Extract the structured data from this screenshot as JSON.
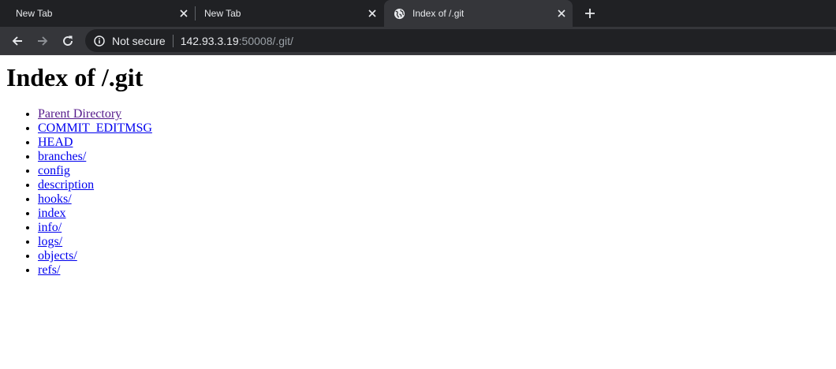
{
  "tabs": [
    {
      "title": "New Tab",
      "active": false
    },
    {
      "title": "New Tab",
      "active": false
    },
    {
      "title": "Index of /.git",
      "active": true
    }
  ],
  "icons": {
    "tab_close": "close-icon",
    "new_tab": "plus-icon",
    "back": "arrow-left-icon",
    "forward": "arrow-right-icon",
    "reload": "reload-icon",
    "site_info": "info-icon",
    "favicon": "globe-icon"
  },
  "address_bar": {
    "security_label": "Not secure",
    "url_host": "142.93.3.19",
    "url_rest": ":50008/.git/"
  },
  "page": {
    "heading": "Index of /.git",
    "entries": [
      {
        "label": "Parent Directory",
        "visited": true
      },
      {
        "label": "COMMIT_EDITMSG",
        "visited": false
      },
      {
        "label": "HEAD",
        "visited": false
      },
      {
        "label": "branches/",
        "visited": false
      },
      {
        "label": "config",
        "visited": false
      },
      {
        "label": "description",
        "visited": false
      },
      {
        "label": "hooks/",
        "visited": false
      },
      {
        "label": "index",
        "visited": false
      },
      {
        "label": "info/",
        "visited": false
      },
      {
        "label": "logs/",
        "visited": false
      },
      {
        "label": "objects/",
        "visited": false
      },
      {
        "label": "refs/",
        "visited": false
      }
    ]
  },
  "colors": {
    "tabstrip_bg": "#202124",
    "toolbar_bg": "#35363a",
    "omnibox_bg": "#202124",
    "link": "#0000ee",
    "link_visited": "#551a8b"
  }
}
